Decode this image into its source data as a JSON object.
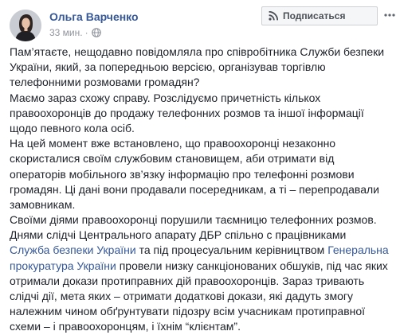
{
  "post": {
    "author": "Ольга Варченко",
    "timestamp": "33 мин.",
    "privacy_icon": "globe-icon",
    "subscribe_icon": "rss-icon",
    "subscribe_label": "Подписаться",
    "more_icon": "more-dots-icon",
    "colors": {
      "link": "#365899",
      "text": "#1d2129",
      "meta": "#90949c",
      "button_bg": "#f5f6f7",
      "button_border": "#ced0d4"
    },
    "lines": [
      [
        {
          "text": "Пам’ятаєте, нещодавно повідомляла про співробітника Служби безпеки"
        }
      ],
      [
        {
          "text": "України, який, за попередньою версією, організував торгівлю"
        }
      ],
      [
        {
          "text": "телефонними розмовами громадян?"
        }
      ],
      [
        {
          "text": "Маємо зараз схожу справу. Розслідуємо причетність кількох"
        }
      ],
      [
        {
          "text": "правоохоронців до продажу телефонних розмов та іншої інформації"
        }
      ],
      [
        {
          "text": "щодо певного кола осіб."
        }
      ],
      [
        {
          "text": "На цей момент вже встановлено, що правоохоронці незаконно"
        }
      ],
      [
        {
          "text": "скористалися своїм службовим становищем, аби отримати від"
        }
      ],
      [
        {
          "text": "операторів мобільного зв’язку інформацію про телефонні розмови"
        }
      ],
      [
        {
          "text": "громадян. Ці дані вони продавали посередникам, а ті – перепродавали"
        }
      ],
      [
        {
          "text": "замовникам."
        }
      ],
      [
        {
          "text": "Своїми діями правоохоронці порушили таємницю телефонних розмов."
        }
      ],
      [
        {
          "text": "Днями слідчі Центрального апарату ДБР спільно с працівниками"
        }
      ],
      [
        {
          "text": "Служба безпеки України",
          "link": true
        },
        {
          "text": " та під процесуальним керівництвом "
        },
        {
          "text": "Генеральна",
          "link": true
        }
      ],
      [
        {
          "text": "прокуратура України",
          "link": true
        },
        {
          "text": " провели низку санкціонованих обшуків, під час яких"
        }
      ],
      [
        {
          "text": "отримали докази протиправних дій правоохоронців. Зараз тривають"
        }
      ],
      [
        {
          "text": "слідчі дії, мета яких – отримати додаткові докази, які дадуть змогу"
        }
      ],
      [
        {
          "text": "належним чином обґрунтувати підозру всім учасникам протиправної"
        }
      ],
      [
        {
          "text": "схеми – і правоохоронцям, і їхнім “клієнтам”."
        }
      ]
    ]
  }
}
